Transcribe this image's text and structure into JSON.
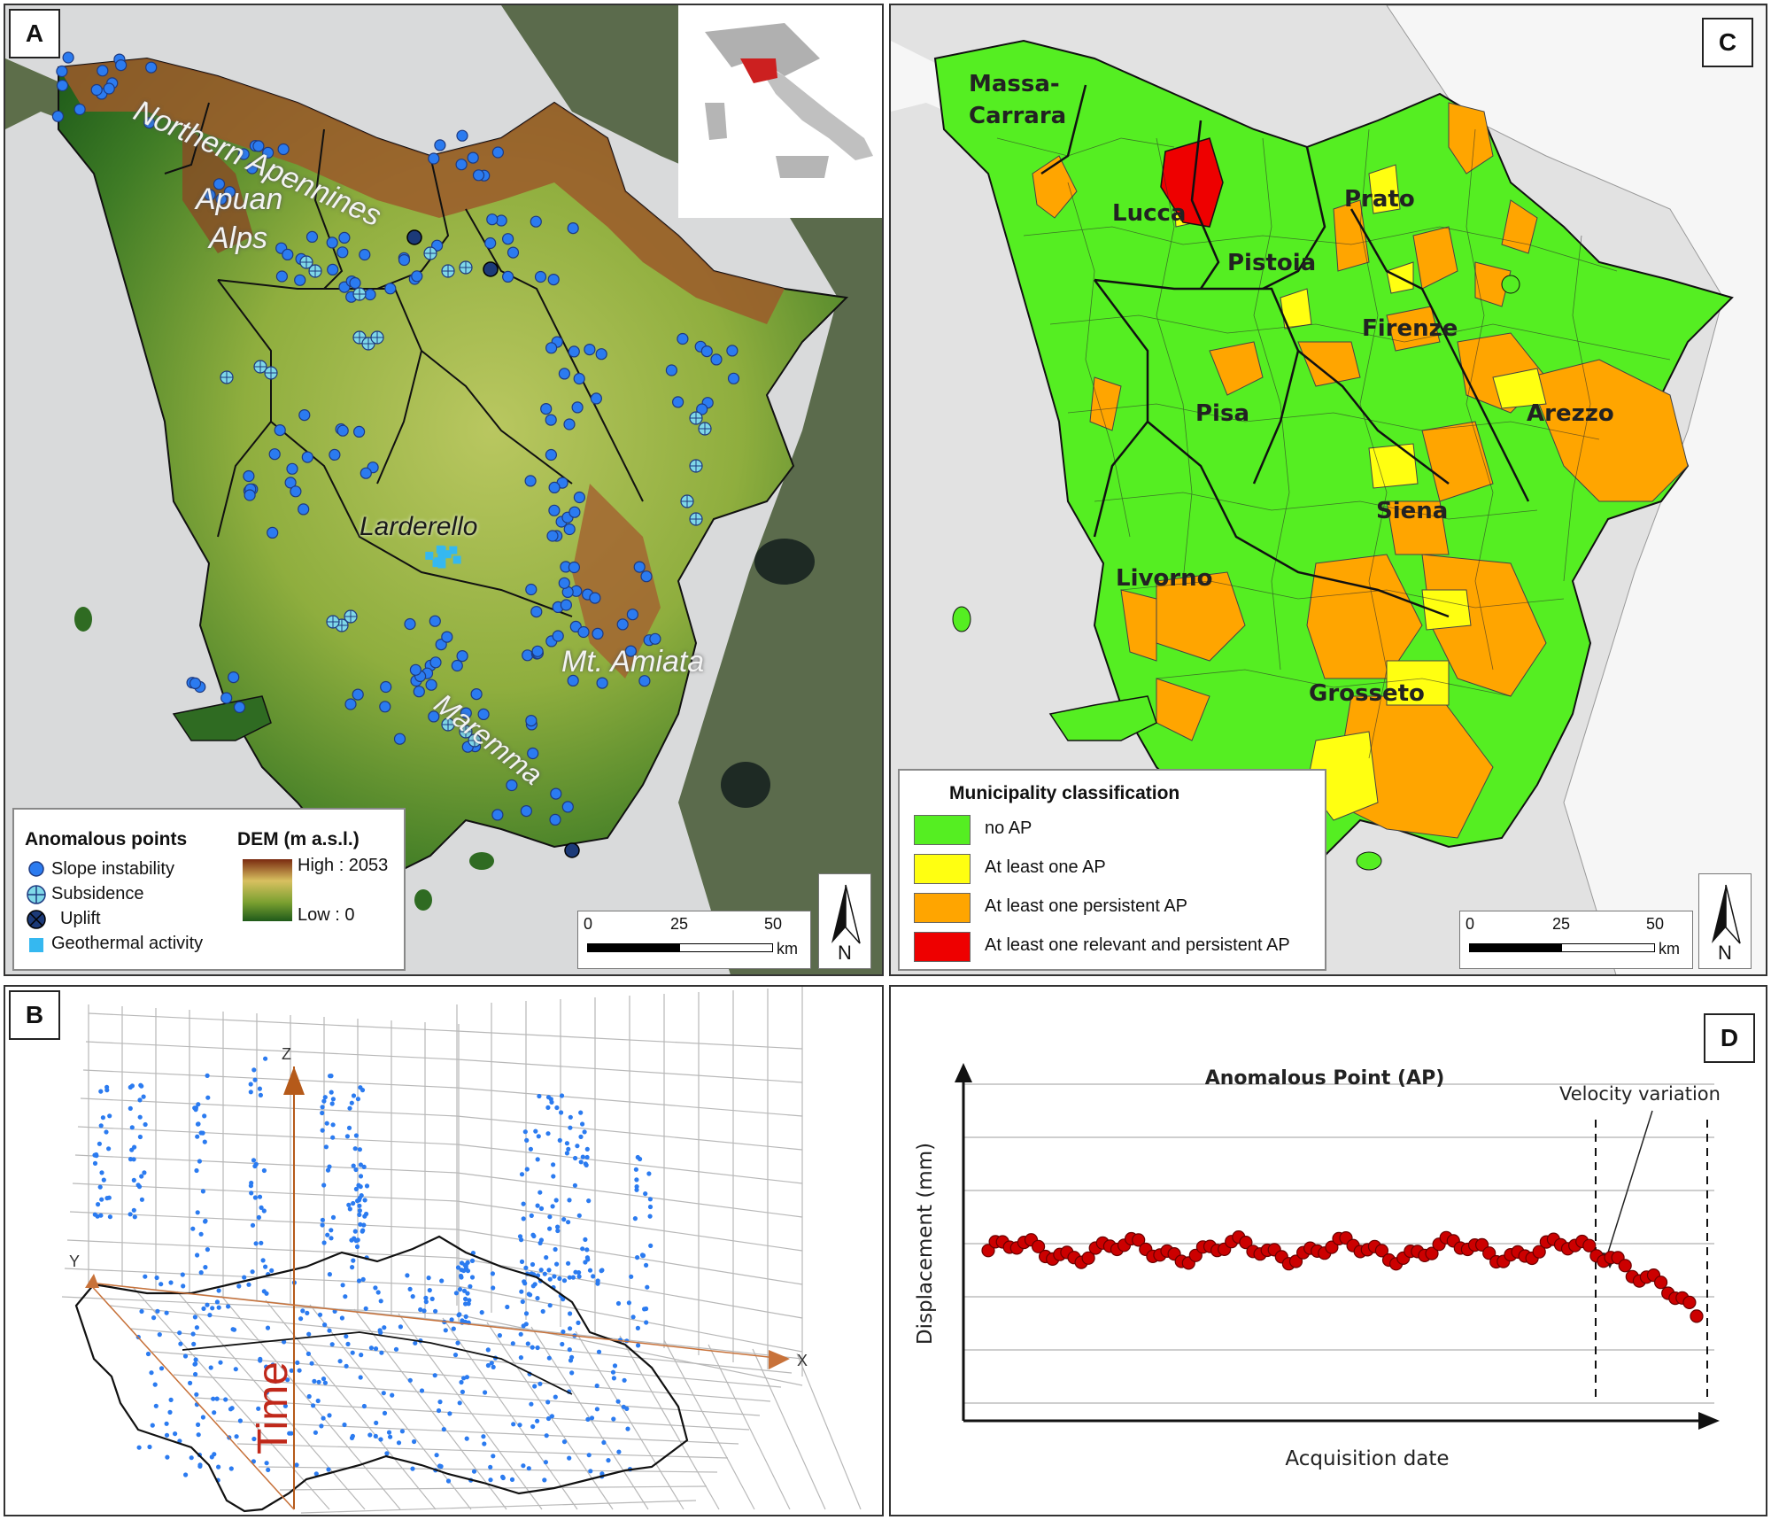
{
  "panel_a": {
    "letter": "A",
    "labels": {
      "northern_apennines": "Northern Apennines",
      "apuan_alps_1": "Apuan",
      "apuan_alps_2": "Alps",
      "larderello": "Larderello",
      "mt_amiata": "Mt. Amiata",
      "maremma": "Maremma"
    },
    "legend": {
      "anomalous_title": "Anomalous points",
      "slope": "Slope instability",
      "subsidence": "Subsidence",
      "uplift": "Uplift",
      "geothermal": "Geothermal activity",
      "dem_title": "DEM (m a.s.l.)",
      "dem_high": "High : 2053",
      "dem_low": "Low : 0"
    },
    "scale": {
      "t0": "0",
      "t1": "25",
      "t2": "50",
      "unit": "km"
    },
    "north": "N",
    "colors": {
      "slope": "#2b7bf0",
      "subsidence": "#7fd8e8",
      "uplift": "#1c3a78",
      "geothermal": "#35b8f0"
    }
  },
  "panel_b": {
    "letter": "B",
    "axis_x": "X",
    "axis_y": "Y",
    "axis_z": "Z",
    "time_label": "Time"
  },
  "panel_c": {
    "letter": "C",
    "provinces": {
      "massa_1": "Massa-",
      "massa_2": "Carrara",
      "lucca": "Lucca",
      "pistoia": "Pistoia",
      "prato": "Prato",
      "firenze": "Firenze",
      "pisa": "Pisa",
      "arezzo": "Arezzo",
      "siena": "Siena",
      "livorno": "Livorno",
      "grosseto": "Grosseto"
    },
    "legend": {
      "title": "Municipality classification",
      "items": [
        {
          "label": "no AP",
          "color": "#55ee22"
        },
        {
          "label": "At least one AP",
          "color": "#ffff11"
        },
        {
          "label": "At least one persistent AP",
          "color": "#ffa500"
        },
        {
          "label": "At least one relevant and persistent AP",
          "color": "#ee0000"
        }
      ]
    },
    "scale": {
      "t0": "0",
      "t1": "25",
      "t2": "50",
      "unit": "km"
    },
    "north": "N"
  },
  "panel_d": {
    "letter": "D",
    "chart_data": {
      "type": "scatter",
      "title": "Anomalous Point (AP)",
      "xlabel": "Acquisition date",
      "ylabel": "Displacement (mm)",
      "annotation": "Velocity variation",
      "point_color": "#cc0000"
    }
  }
}
